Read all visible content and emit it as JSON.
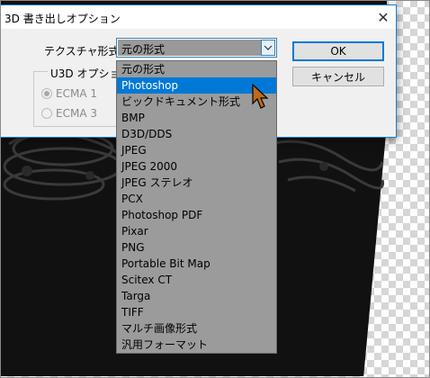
{
  "dialog": {
    "title": "3D 書き出しオプション",
    "texture_label": "テクスチャ形式：",
    "selected_value": "元の形式",
    "ok_label": "OK",
    "cancel_label": "キャンセル",
    "u3d_group_label": "U3D オプション",
    "radio_ecma1": "ECMA 1",
    "radio_ecma3": "ECMA 3",
    "close_icon": "close-icon"
  },
  "dropdown": {
    "highlighted_index": 1,
    "items": [
      "元の形式",
      "Photoshop",
      "ビックドキュメント形式",
      "BMP",
      "D3D/DDS",
      "JPEG",
      "JPEG 2000",
      "JPEG ステレオ",
      "PCX",
      "Photoshop PDF",
      "Pixar",
      "PNG",
      "Portable Bit Map",
      "Scitex CT",
      "Targa",
      "TIFF",
      "マルチ画像形式",
      "汎用フォーマット"
    ]
  },
  "colors": {
    "accent": "#0078d7",
    "dialog_bg": "#f0f0f0",
    "dropdown_bg": "#9b9b9b",
    "cursor": "#c06a1a"
  }
}
